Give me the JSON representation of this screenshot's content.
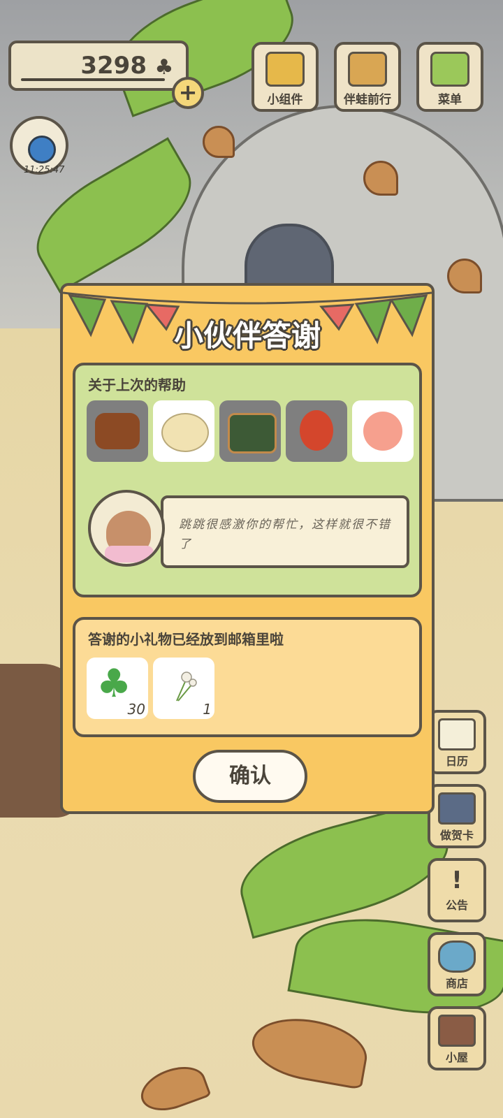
{
  "hud": {
    "clover_count": "3298",
    "clock": "11:25:47"
  },
  "top_menu": [
    {
      "label": "小组件",
      "icon": "widget-icon"
    },
    {
      "label": "伴蛙前行",
      "icon": "journey-icon"
    },
    {
      "label": "菜单",
      "icon": "menu-cards-icon"
    }
  ],
  "side_menu": [
    {
      "label": "日历",
      "icon": "calendar-icon"
    },
    {
      "label": "做贺卡",
      "icon": "greeting-card-icon"
    },
    {
      "label": "公告",
      "icon": "notice-icon"
    },
    {
      "label": "商店",
      "icon": "shop-bag-icon"
    },
    {
      "label": "小屋",
      "icon": "house-icon"
    }
  ],
  "dialog": {
    "title": "小伙伴答谢",
    "help_section": {
      "heading": "关于上次的帮助",
      "foods": [
        {
          "icon": "meat-skewer-icon",
          "style": "dark"
        },
        {
          "icon": "noodle-plate-icon",
          "style": "light"
        },
        {
          "icon": "soba-bowl-icon",
          "style": "dark"
        },
        {
          "icon": "mango-icon",
          "style": "dark"
        },
        {
          "icon": "peach-icon",
          "style": "light"
        }
      ],
      "message": "跳跳很感激你的帮忙，这样就很不错了"
    },
    "gift_section": {
      "heading": "答谢的小礼物已经放到邮箱里啦",
      "gifts": [
        {
          "icon": "clover-icon",
          "count": "30"
        },
        {
          "icon": "dandelion-icon",
          "count": "1"
        }
      ]
    },
    "confirm_label": "确认"
  },
  "colors": {
    "dialog_bg": "#f9c862",
    "help_panel_bg": "#cfe29a",
    "gift_panel_bg": "#fcdb96",
    "outline": "#5b5448"
  }
}
